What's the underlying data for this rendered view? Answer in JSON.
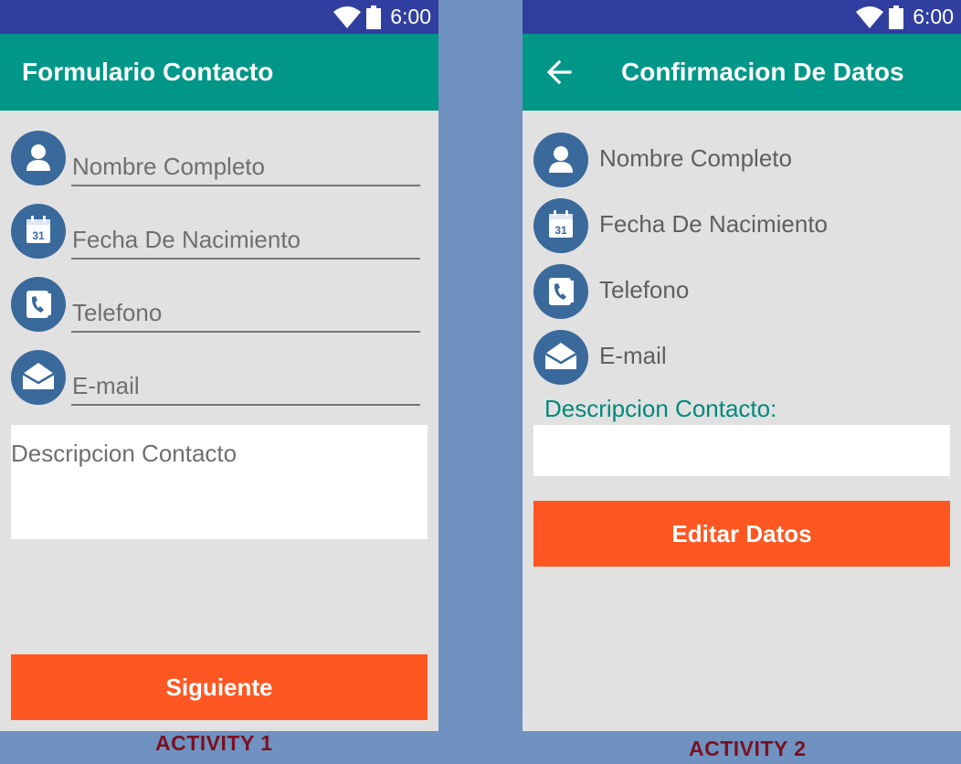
{
  "status_bar": {
    "time": "6:00"
  },
  "activity1": {
    "title": "Formulario Contacto",
    "fields": [
      {
        "icon": "person-icon",
        "placeholder": "Nombre Completo"
      },
      {
        "icon": "calendar-icon",
        "placeholder": "Fecha De Nacimiento"
      },
      {
        "icon": "phone-icon",
        "placeholder": "Telefono"
      },
      {
        "icon": "email-icon",
        "placeholder": "E-mail"
      }
    ],
    "description_placeholder": "Descripcion Contacto",
    "button_label": "Siguiente",
    "caption": "ACTIVITY 1"
  },
  "activity2": {
    "title": "Confirmacion De Datos",
    "rows": [
      {
        "icon": "person-icon",
        "label": "Nombre Completo"
      },
      {
        "icon": "calendar-icon",
        "label": "Fecha De Nacimiento"
      },
      {
        "icon": "phone-icon",
        "label": "Telefono"
      },
      {
        "icon": "email-icon",
        "label": "E-mail"
      }
    ],
    "description_label": "Descripcion Contacto:",
    "button_label": "Editar Datos",
    "caption": "ACTIVITY 2"
  },
  "colors": {
    "status_bar": "#303f9f",
    "app_bar": "#009688",
    "accent_button": "#ff5722",
    "icon_circle": "#3a699b",
    "screen_bg": "#e1e1e1",
    "page_bg": "#6f92c0",
    "caption_text": "#7b1020"
  },
  "calendar_icon_day": "31"
}
